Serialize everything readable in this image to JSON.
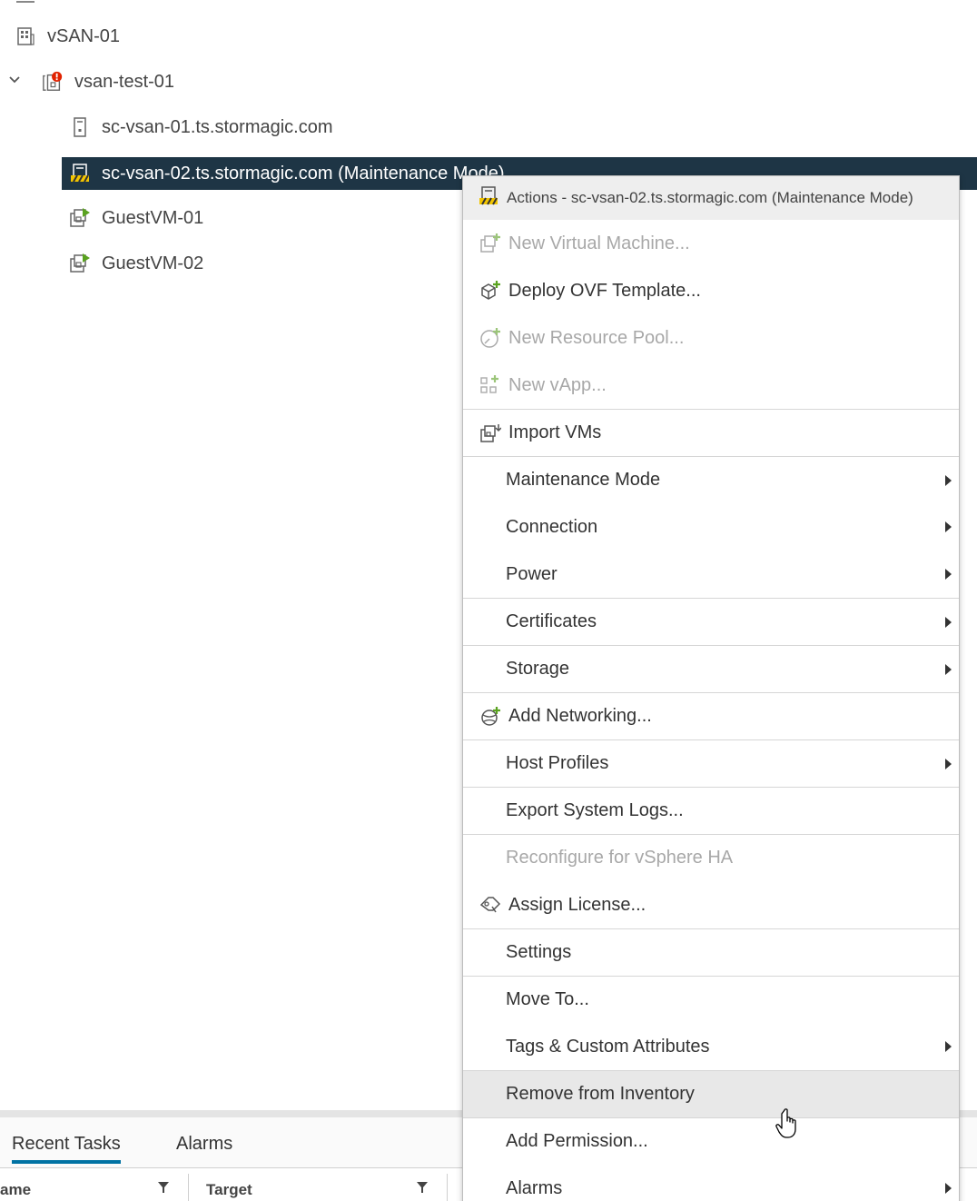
{
  "tree": {
    "datacenter": "vSAN-01",
    "cluster": "vsan-test-01",
    "host1": "sc-vsan-01.ts.stormagic.com",
    "host2_selected": "sc-vsan-02.ts.stormagic.com (Maintenance Mode)",
    "vm1": "GuestVM-01",
    "vm2": "GuestVM-02"
  },
  "menu": {
    "header": "Actions - sc-vsan-02.ts.stormagic.com (Maintenance Mode)",
    "items": [
      {
        "label": "New Virtual Machine...",
        "icon": "new-vm-icon",
        "disabled": true
      },
      {
        "label": "Deploy OVF Template...",
        "icon": "deploy-ovf-icon",
        "disabled": false
      },
      {
        "label": "New Resource Pool...",
        "icon": "resource-pool-icon",
        "disabled": true
      },
      {
        "label": "New vApp...",
        "icon": "vapp-icon",
        "disabled": true
      },
      {
        "label": "Import VMs",
        "icon": "import-vms-icon",
        "disabled": false
      },
      {
        "label": "Maintenance Mode",
        "submenu": true
      },
      {
        "label": "Connection",
        "submenu": true
      },
      {
        "label": "Power",
        "submenu": true
      },
      {
        "label": "Certificates",
        "submenu": true
      },
      {
        "label": "Storage",
        "submenu": true
      },
      {
        "label": "Add Networking...",
        "icon": "add-networking-icon"
      },
      {
        "label": "Host Profiles",
        "submenu": true
      },
      {
        "label": "Export System Logs..."
      },
      {
        "label": "Reconfigure for vSphere HA",
        "disabled": true
      },
      {
        "label": "Assign License...",
        "icon": "license-icon"
      },
      {
        "label": "Settings"
      },
      {
        "label": "Move To..."
      },
      {
        "label": "Tags & Custom Attributes",
        "submenu": true
      },
      {
        "label": "Remove from Inventory",
        "hovered": true
      },
      {
        "label": "Add Permission..."
      },
      {
        "label": "Alarms",
        "submenu": true
      }
    ]
  },
  "bottom": {
    "tab_recent": "Recent Tasks",
    "tab_alarms": "Alarms",
    "col_name": "ame",
    "col_target": "Target"
  },
  "colors": {
    "selected_row": "#1e3545",
    "accent": "#0072a3",
    "green_plus": "#5aa220",
    "alert": "#e12200"
  }
}
